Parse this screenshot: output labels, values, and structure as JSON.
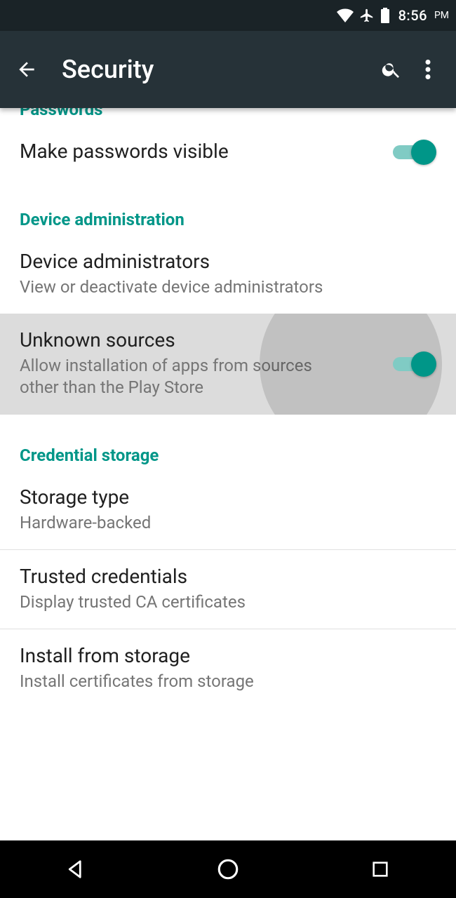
{
  "status": {
    "time": "8:56",
    "ampm": "PM"
  },
  "appbar": {
    "title": "Security"
  },
  "sections": {
    "passwords": {
      "header": "Passwords",
      "make_visible": {
        "title": "Make passwords visible",
        "toggle": true
      }
    },
    "device_admin": {
      "header": "Device administration",
      "device_admins": {
        "title": "Device administrators",
        "sub": "View or deactivate device administrators"
      },
      "unknown_sources": {
        "title": "Unknown sources",
        "sub": "Allow installation of apps from sources other than the Play Store",
        "toggle": true
      }
    },
    "credential_storage": {
      "header": "Credential storage",
      "storage_type": {
        "title": "Storage type",
        "sub": "Hardware-backed"
      },
      "trusted_credentials": {
        "title": "Trusted credentials",
        "sub": "Display trusted CA certificates"
      },
      "install_from_storage": {
        "title": "Install from storage",
        "sub": "Install certificates from storage"
      }
    }
  }
}
